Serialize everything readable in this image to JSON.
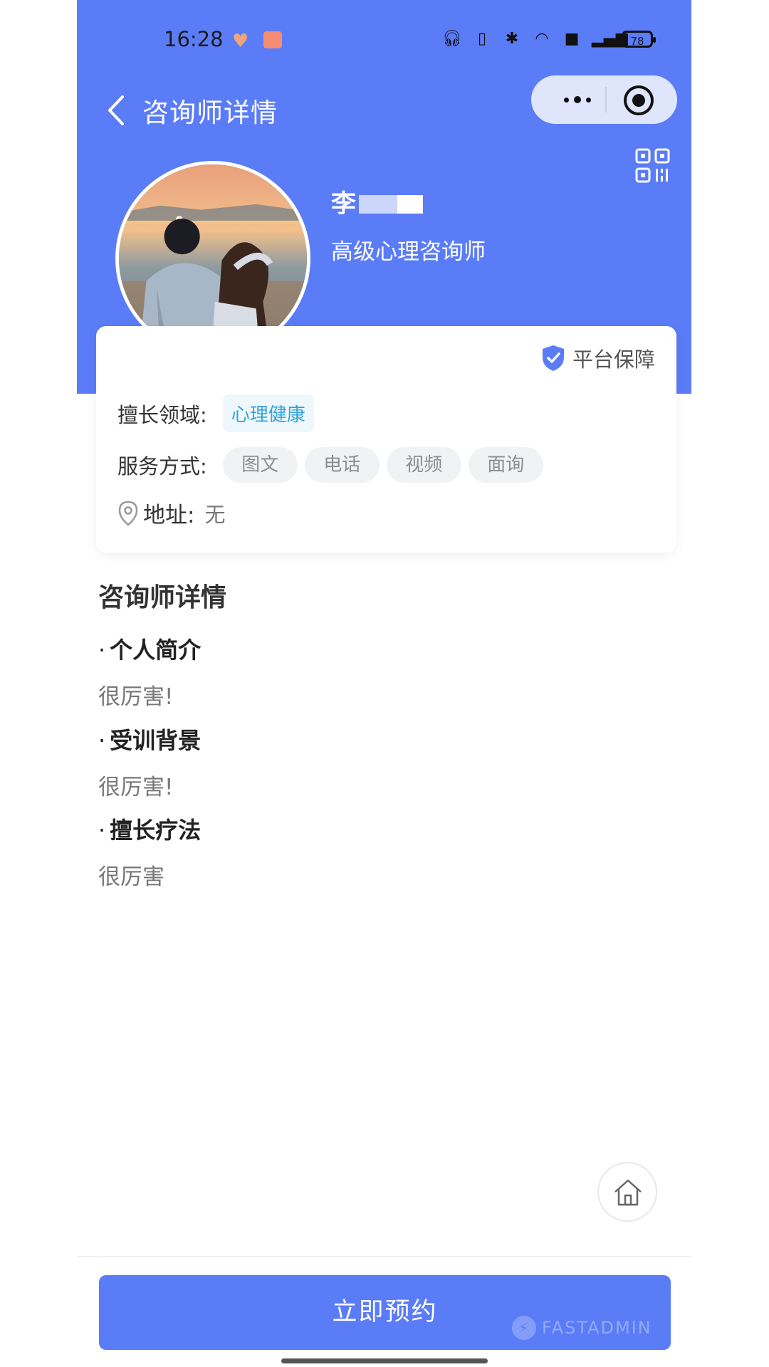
{
  "status_bar": {
    "time": "16:28",
    "icons": [
      "heart-icon",
      "app-icon",
      "headphones-icon",
      "vibrate-icon",
      "bluetooth-icon",
      "wifi-icon",
      "hd-icon",
      "signal-5g-icon"
    ],
    "battery": "78"
  },
  "nav": {
    "title": "咨询师详情",
    "capsule_icons": [
      "more-icon",
      "target-icon"
    ]
  },
  "profile": {
    "name": "李",
    "title": "高级心理咨询师"
  },
  "card": {
    "guarantee": "平台保障",
    "specialty_label": "擅长领域:",
    "specialty_tag": "心理健康",
    "service_label": "服务方式:",
    "service_tags": [
      "图文",
      "电话",
      "视频",
      "面询"
    ],
    "address_label": "地址:",
    "address_value": "无"
  },
  "details": {
    "section_title": "咨询师详情",
    "items": [
      {
        "heading": "个人简介",
        "text": "很厉害!"
      },
      {
        "heading": "受训背景",
        "text": "很厉害!"
      },
      {
        "heading": "擅长疗法",
        "text": "很厉害"
      }
    ]
  },
  "bottom": {
    "book_label": "立即预约",
    "watermark": "FASTADMIN"
  },
  "colors": {
    "primary": "#5b7cf7",
    "tag_blue": "#36a3d9"
  }
}
